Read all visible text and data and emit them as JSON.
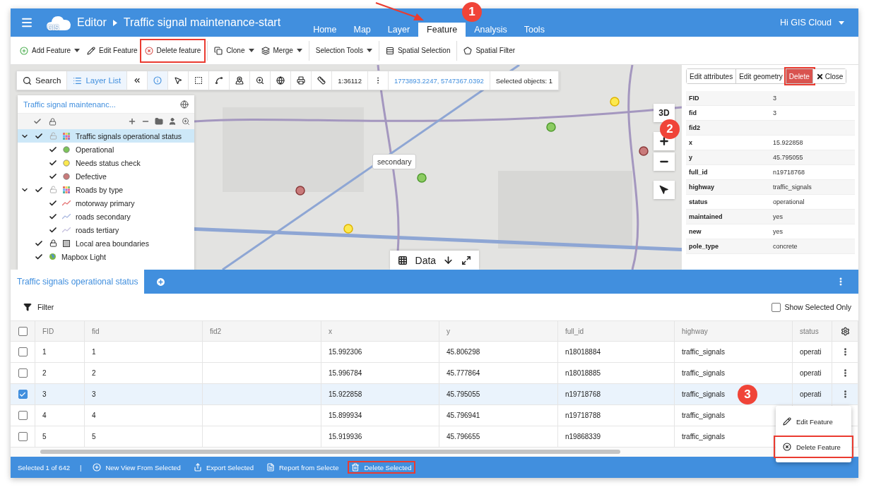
{
  "header": {
    "logo": "GIS",
    "app": "Editor",
    "document": "Traffic signal maintenance-start",
    "tabs": [
      {
        "label": "Home",
        "selected": false
      },
      {
        "label": "Map",
        "selected": false
      },
      {
        "label": "Layer",
        "selected": false
      },
      {
        "label": "Feature",
        "selected": true
      },
      {
        "label": "Analysis",
        "selected": false
      },
      {
        "label": "Tools",
        "selected": false
      }
    ],
    "user": "Hi GIS Cloud"
  },
  "toolbar": {
    "groups": [
      [
        {
          "label": "Add Feature",
          "kind": "add",
          "dropdown": true
        },
        {
          "label": "Edit Feature",
          "kind": "edit",
          "dropdown": false
        },
        {
          "label": "Delete feature",
          "kind": "delete",
          "dropdown": false,
          "highlighted": true
        }
      ],
      [
        {
          "label": "Clone",
          "kind": "clone",
          "dropdown": true
        },
        {
          "label": "Merge",
          "kind": "merge",
          "dropdown": true
        }
      ],
      [
        {
          "label": "Selection Tools",
          "kind": "text",
          "dropdown": true
        }
      ],
      [
        {
          "label": "Spatial Selection",
          "kind": "spatial_selection",
          "dropdown": false
        }
      ],
      [
        {
          "label": "Spatial Filter",
          "kind": "spatial_filter",
          "dropdown": false
        }
      ]
    ]
  },
  "map": {
    "toolbar": {
      "buttons": [
        {
          "label": "Search",
          "kind": "search",
          "active": false
        },
        {
          "label": "Layer List",
          "kind": "list",
          "active": true
        }
      ],
      "tools": [
        {
          "kind": "collapse",
          "active": false
        },
        {
          "kind": "info",
          "active": true
        },
        {
          "kind": "pointer",
          "active": false
        },
        {
          "kind": "select_box",
          "active": false
        },
        {
          "kind": "lasso",
          "active": false
        },
        {
          "kind": "pin",
          "active": false
        },
        {
          "kind": "zoom",
          "active": false
        },
        {
          "kind": "globe",
          "active": false
        },
        {
          "kind": "print",
          "active": false
        },
        {
          "kind": "measure",
          "active": false
        }
      ],
      "scale": "1:36112",
      "coordinates": "1773893.2247, 5747367.0392",
      "selected_objects": "Selected objects: 1"
    },
    "tooltip": "secondary",
    "three_d": "3D",
    "data_bar": "Data"
  },
  "layer_panel": {
    "title": "Traffic signal maintenanc...",
    "layers": [
      {
        "name": "Traffic signals operational status",
        "kind": "grid",
        "visible": true,
        "locked": false,
        "selected": true,
        "expanded": true,
        "children": [
          {
            "name": "Operational",
            "kind": "dot",
            "color": "#7dc45a",
            "visible": true
          },
          {
            "name": "Needs status check",
            "kind": "dot",
            "color": "#fce94f",
            "visible": true
          },
          {
            "name": "Defective",
            "kind": "dot",
            "color": "#c97b7b",
            "visible": true
          }
        ]
      },
      {
        "name": "Roads by type",
        "kind": "grid",
        "visible": true,
        "locked": false,
        "selected": false,
        "expanded": true,
        "children": [
          {
            "name": "motorway primary",
            "kind": "line",
            "color": "#e57373",
            "visible": true
          },
          {
            "name": "roads secondary",
            "kind": "line",
            "color": "#a9b8e0",
            "visible": true
          },
          {
            "name": "roads tertiary",
            "kind": "line",
            "color": "#c5c0dd",
            "visible": true
          }
        ]
      },
      {
        "name": "Local area boundaries",
        "kind": "square",
        "visible": true,
        "locked": true,
        "selected": false
      },
      {
        "name": "Mapbox Light",
        "kind": "globe",
        "visible": true,
        "selected": false
      }
    ]
  },
  "attribute_panel": {
    "buttons": [
      {
        "label": "Edit attributes",
        "kind": "plain"
      },
      {
        "label": "Edit geometry",
        "kind": "plain"
      },
      {
        "label": "Delete",
        "kind": "danger",
        "highlighted": true
      },
      {
        "label": "Close",
        "kind": "close"
      }
    ],
    "fields": [
      {
        "name": "FID",
        "value": "3"
      },
      {
        "name": "fid",
        "value": "3"
      },
      {
        "name": "fid2"
      },
      {
        "name": "x",
        "value": "15.922858"
      },
      {
        "name": "y",
        "value": "45.795055"
      },
      {
        "name": "full_id",
        "value": "n19718768"
      },
      {
        "name": "highway",
        "value": "traffic_signals"
      },
      {
        "name": "status",
        "value": "operational"
      },
      {
        "name": "maintained",
        "value": "yes"
      },
      {
        "name": "new",
        "value": "yes"
      },
      {
        "name": "pole_type",
        "value": "concrete"
      }
    ]
  },
  "table": {
    "tab": {
      "label": "Traffic signals operational status",
      "selected": true
    },
    "filter": "Filter",
    "show_selected_only": {
      "label": "Show Selected Only",
      "checked": false
    },
    "select_all_checked": false,
    "columns": [
      "FID",
      "fid",
      "fid2",
      "x",
      "y",
      "full_id",
      "highway",
      "status"
    ],
    "rows": [
      {
        "selected": false,
        "cells": [
          "1",
          "1",
          null,
          "15.992306",
          "45.806298",
          "n18018884",
          "traffic_signals",
          "operati"
        ]
      },
      {
        "selected": false,
        "cells": [
          "2",
          "2",
          null,
          "15.996784",
          "45.777864",
          "n18018885",
          "traffic_signals",
          "operati"
        ]
      },
      {
        "selected": true,
        "cells": [
          "3",
          "3",
          null,
          "15.922858",
          "45.795055",
          "n19718768",
          "traffic_signals",
          "operati"
        ]
      },
      {
        "selected": false,
        "cells": [
          "4",
          "4",
          null,
          "15.899934",
          "45.796941",
          "n19718788",
          "traffic_signals"
        ]
      },
      {
        "selected": false,
        "cells": [
          "5",
          "5",
          null,
          "15.919936",
          "45.796655",
          "n19868339",
          "traffic_signals"
        ]
      }
    ]
  },
  "context_menu": [
    {
      "label": "Edit Feature",
      "kind": "edit"
    },
    {
      "label": "Delete Feature",
      "kind": "delete",
      "highlighted": true
    }
  ],
  "status_bar": {
    "summary": "Selected 1 of 642",
    "separator": "|",
    "actions": [
      {
        "label": "New View From Selected",
        "kind": "new_view"
      },
      {
        "label": "Export Selected",
        "kind": "export"
      },
      {
        "label": "Report from Selecte",
        "kind": "report"
      },
      {
        "label": "Delete Selected",
        "kind": "trash",
        "highlighted": true
      }
    ]
  },
  "annotations": {
    "badges": [
      "1",
      "2",
      "3"
    ]
  }
}
